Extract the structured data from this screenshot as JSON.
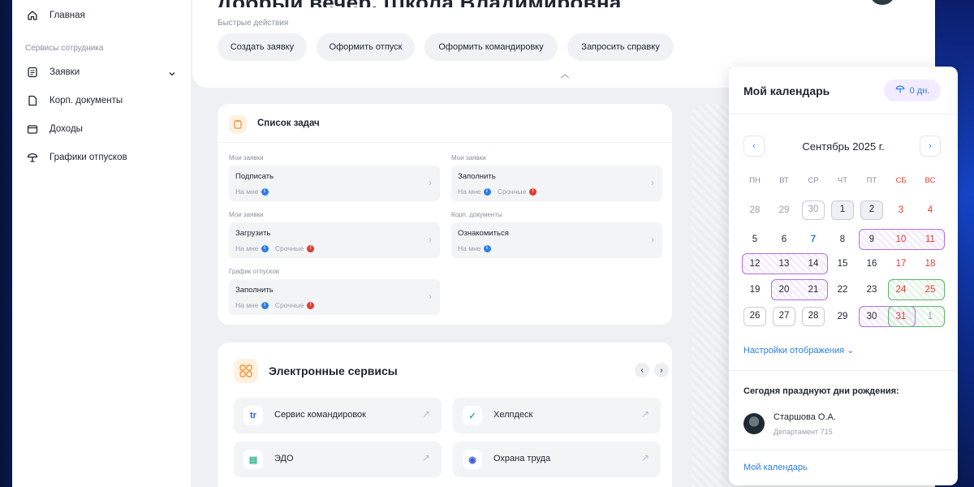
{
  "sidebar": {
    "home": "Главная",
    "section": "Сервисы сотрудника",
    "items": [
      {
        "label": "Заявки",
        "icon": "requests-icon"
      },
      {
        "label": "Корп. документы",
        "icon": "document-icon"
      },
      {
        "label": "Доходы",
        "icon": "wallet-icon"
      },
      {
        "label": "Графики отпусков",
        "icon": "umbrella-icon"
      }
    ]
  },
  "header": {
    "greeting": "Добрый вечер, Школа Владимировна",
    "quick_actions_label": "Быстрые действия",
    "quick_actions": [
      "Создать заявку",
      "Оформить отпуск",
      "Оформить командировку",
      "Запросить справку"
    ]
  },
  "tasks": {
    "title": "Список задач",
    "items": [
      {
        "category": "Мои заявки",
        "title": "Подписать",
        "meta1": "На мне",
        "meta2": ""
      },
      {
        "category": "Мои заявки",
        "title": "Заполнить",
        "meta1": "На мне",
        "meta2": "Срочные"
      },
      {
        "category": "Мои заявки",
        "title": "Загрузить",
        "meta1": "На мне",
        "meta2": "Срочные"
      },
      {
        "category": "Корп. документы",
        "title": "Ознакомиться",
        "meta1": "На мне",
        "meta2": ""
      },
      {
        "category": "График отпусков",
        "title": "Заполнить",
        "meta1": "На мне",
        "meta2": "Срочные"
      }
    ]
  },
  "services": {
    "title": "Электронные сервисы",
    "items": [
      {
        "label": "Сервис командировок",
        "glyph": "tr",
        "color": "#2b5fd9"
      },
      {
        "label": "Хелпдеск",
        "glyph": "✓",
        "color": "#27b07a"
      },
      {
        "label": "ЭДО",
        "glyph": "▤",
        "color": "#2bb08a"
      },
      {
        "label": "Охрана труда",
        "glyph": "◉",
        "color": "#3b5bd9"
      }
    ]
  },
  "calendar": {
    "title": "Мой календарь",
    "vacation_badge": "0 дн.",
    "month": "Сентябрь 2025 г.",
    "weekdays": [
      "ПН",
      "ВТ",
      "СР",
      "ЧТ",
      "ПТ",
      "СБ",
      "ВС"
    ],
    "weeks": [
      [
        "28",
        "29",
        "30",
        "1",
        "2",
        "3",
        "4"
      ],
      [
        "5",
        "6",
        "7",
        "8",
        "9",
        "10",
        "11"
      ],
      [
        "12",
        "13",
        "14",
        "15",
        "16",
        "17",
        "18"
      ],
      [
        "19",
        "20",
        "21",
        "22",
        "23",
        "24",
        "25"
      ],
      [
        "26",
        "27",
        "28",
        "29",
        "30",
        "31",
        "1"
      ]
    ],
    "display_settings": "Настройки отображения",
    "birthdays_title": "Сегодня празднуют дни рождения:",
    "birthday_person": {
      "name": "Старшова О.А.",
      "dept": "Департамент 715"
    },
    "footer_link": "Мой календарь",
    "colors": {
      "accent": "#2b7de9",
      "weekend": "#e5392f",
      "vacation": "#b46ee0",
      "holiday": "#5bb56a"
    }
  }
}
